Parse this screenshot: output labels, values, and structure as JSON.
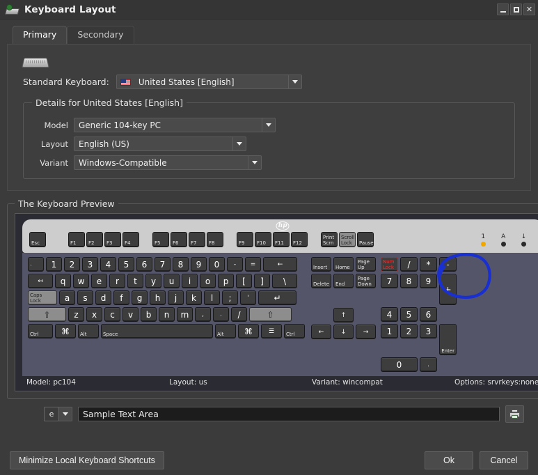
{
  "window": {
    "title": "Keyboard Layout",
    "icon": "keyboard-globe-icon",
    "minimize": "_",
    "maximize": "□",
    "close": "✕"
  },
  "tabs": [
    {
      "label": "Primary",
      "active": true
    },
    {
      "label": "Secondary",
      "active": false
    }
  ],
  "primary": {
    "keyboard_icon": "keyboard-icon",
    "standard_keyboard": {
      "label": "Standard Keyboard:",
      "value": "United States [English]",
      "flag": "us-flag-icon"
    },
    "details": {
      "legend": "Details for United States [English]",
      "fields": [
        {
          "label": "Model",
          "value": "Generic 104-key PC"
        },
        {
          "label": "Layout",
          "value": "English (US)"
        },
        {
          "label": "Variant",
          "value": "Windows-Compatible"
        }
      ]
    }
  },
  "preview": {
    "legend": "The Keyboard Preview",
    "brand": "hp",
    "leds": [
      {
        "name": "1",
        "on": true
      },
      {
        "name": "A",
        "on": false
      },
      {
        "name": "↓",
        "on": false
      }
    ],
    "function_row": {
      "esc": "Esc",
      "groups": [
        [
          "F1",
          "F2",
          "F3",
          "F4"
        ],
        [
          "F5",
          "F6",
          "F7",
          "F8"
        ],
        [
          "F9",
          "F10",
          "F11",
          "F12"
        ]
      ],
      "system": [
        {
          "line1": "Print",
          "line2": "Scrn",
          "lit": false
        },
        {
          "line1": "Scroll",
          "line2": "Lock",
          "lit": true
        },
        {
          "line1": "Pause",
          "line2": "",
          "lit": false
        }
      ]
    },
    "main_rows": {
      "row1": [
        "`",
        "1",
        "2",
        "3",
        "4",
        "5",
        "6",
        "7",
        "8",
        "9",
        "0",
        "-",
        "=",
        "←"
      ],
      "row2": [
        "↤",
        "q",
        "w",
        "e",
        "r",
        "t",
        "y",
        "u",
        "i",
        "o",
        "p",
        "[",
        "]",
        "\\"
      ],
      "row3_caps": "Caps Lock",
      "row3": [
        "a",
        "s",
        "d",
        "f",
        "g",
        "h",
        "j",
        "k",
        "l",
        ";",
        "'",
        "↵"
      ],
      "row4_shift": "⇧",
      "row4": [
        "z",
        "x",
        "c",
        "v",
        "b",
        "n",
        "m",
        ",",
        ".",
        "/"
      ],
      "row5": [
        "Ctrl",
        "⌘",
        "Alt",
        "Space",
        "Alt",
        "⌘",
        "☰",
        "Ctrl"
      ],
      "space_label": "Space"
    },
    "nav_cluster": [
      [
        "Insert",
        "Home",
        "Page Up"
      ],
      [
        "Delete",
        "End",
        "Page Down"
      ]
    ],
    "arrows": {
      "up": "↑",
      "left": "←",
      "down": "↓",
      "right": "→"
    },
    "numpad": {
      "numlock": "Num Lock",
      "row1": [
        "/",
        "*",
        "-"
      ],
      "row2": [
        "7",
        "8",
        "9"
      ],
      "plus": "+",
      "row3": [
        "4",
        "5",
        "6"
      ],
      "row4": [
        "1",
        "2",
        "3"
      ],
      "zero": "0",
      "dot": ".",
      "enter": "Enter"
    },
    "highlight": {
      "key": "Num Lock",
      "key_color": "#ff2a2a",
      "annotation": "hand-drawn-blue-circle",
      "annotation_color": "#1a2fd0"
    },
    "status": [
      "Model: pc104",
      "Layout: us",
      "Variant: wincompat",
      "Options: srvrkeys:none"
    ]
  },
  "sample": {
    "lang_badge": "e",
    "text_value": "Sample Text Area",
    "print_icon": "printer-icon"
  },
  "footer": {
    "minimize_shortcuts": "Minimize Local Keyboard Shortcuts",
    "ok": "Ok",
    "cancel": "Cancel"
  }
}
